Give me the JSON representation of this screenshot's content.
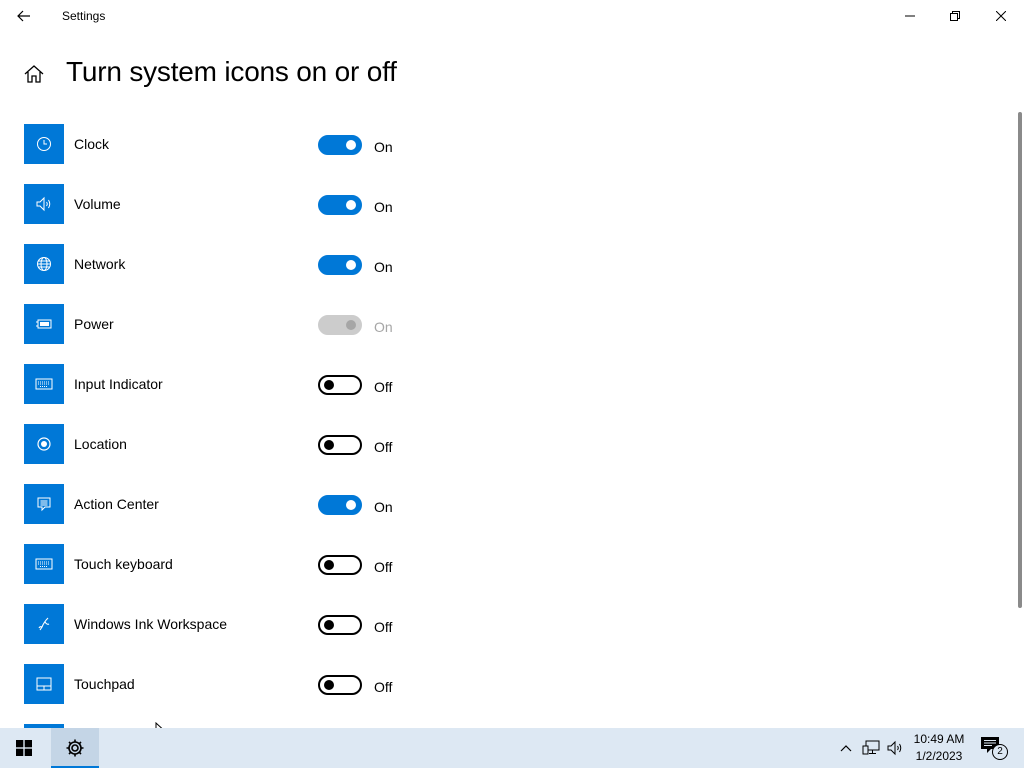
{
  "window": {
    "title": "Settings"
  },
  "page": {
    "title": "Turn system icons on or off"
  },
  "toggles": [
    {
      "label": "Clock",
      "state": "On",
      "icon": "clock-icon"
    },
    {
      "label": "Volume",
      "state": "On",
      "icon": "volume-icon"
    },
    {
      "label": "Network",
      "state": "On",
      "icon": "network-globe-icon"
    },
    {
      "label": "Power",
      "state": "On",
      "icon": "battery-icon",
      "disabled": true
    },
    {
      "label": "Input Indicator",
      "state": "Off",
      "icon": "keyboard-icon"
    },
    {
      "label": "Location",
      "state": "Off",
      "icon": "location-icon"
    },
    {
      "label": "Action Center",
      "state": "On",
      "icon": "action-center-icon"
    },
    {
      "label": "Touch keyboard",
      "state": "Off",
      "icon": "touch-keyboard-icon"
    },
    {
      "label": "Windows Ink Workspace",
      "state": "Off",
      "icon": "pen-icon"
    },
    {
      "label": "Touchpad",
      "state": "Off",
      "icon": "touchpad-icon"
    }
  ],
  "taskbar": {
    "time": "10:49 AM",
    "date": "1/2/2023",
    "notification_count": "2"
  },
  "colors": {
    "accent": "#0078d7",
    "taskbar": "#dde8f3",
    "disabled": "#cccccc"
  }
}
